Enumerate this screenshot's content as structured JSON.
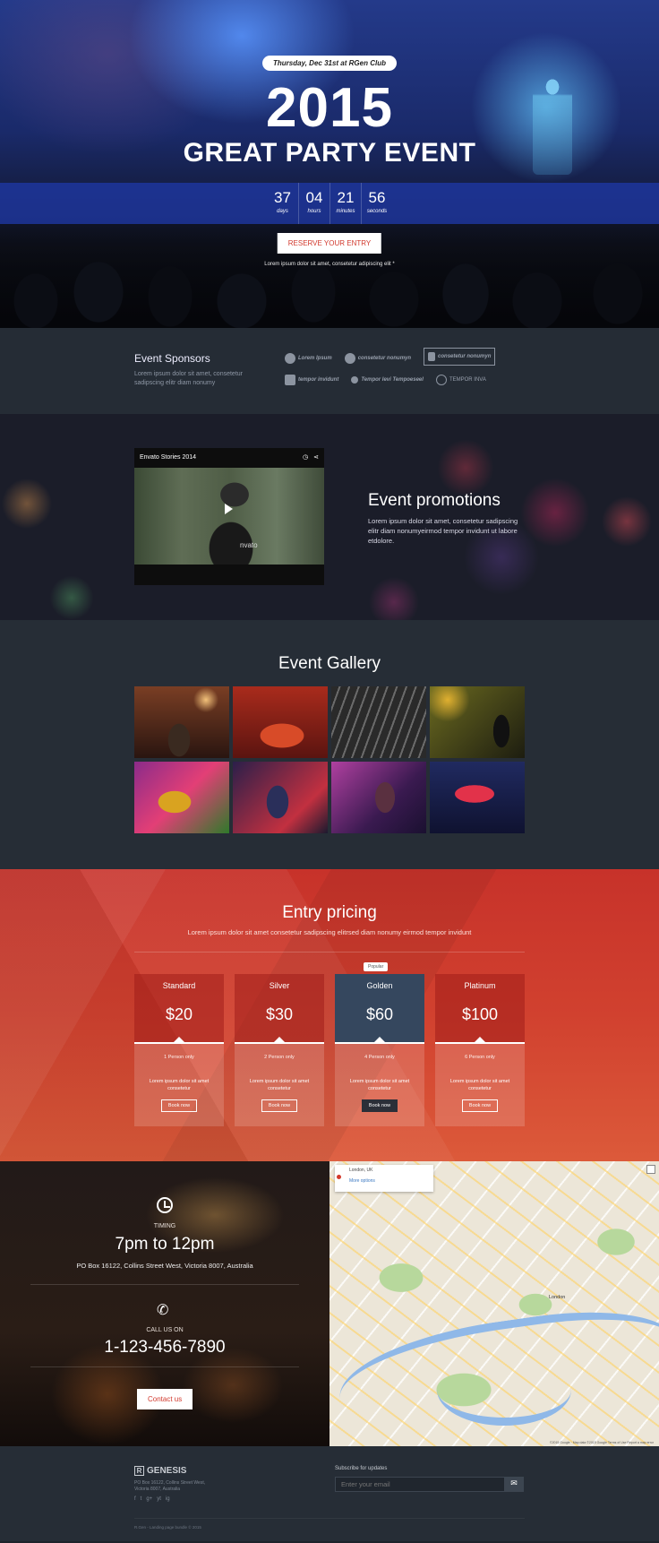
{
  "hero": {
    "date_badge": "Thursday, Dec 31st at RGen Club",
    "year": "2015",
    "title": "GREAT PARTY EVENT",
    "countdown": [
      {
        "value": "37",
        "label": "days"
      },
      {
        "value": "04",
        "label": "hours"
      },
      {
        "value": "21",
        "label": "minutes"
      },
      {
        "value": "56",
        "label": "seconds"
      }
    ],
    "reserve_label": "RESERVE YOUR ENTRY",
    "note": "Lorem ipsum dolor sit amet, consetetur adipiscing elit *"
  },
  "sponsors": {
    "title": "Event Sponsors",
    "text": "Lorem ipsum dolor sit amet, consetetur sadipscing elitr diam nonumy",
    "logos": [
      {
        "label": "Lorem Ipsum",
        "icon": "download-icon"
      },
      {
        "label": "consetetur nonumyn",
        "icon": "circle-logo-icon"
      },
      {
        "label": "consetetur nonumyn",
        "icon": "hourglass-icon"
      },
      {
        "label": "tempor invidunt",
        "icon": "search-logo-icon"
      },
      {
        "label": "Tempor levi Tempoeseel",
        "icon": "key-logo-icon"
      },
      {
        "label": "TEMPOR INVA",
        "icon": "globe-logo-icon"
      }
    ]
  },
  "promo": {
    "video_title": "Envato Stories 2014",
    "video_watermark": "nvato",
    "title": "Event promotions",
    "text": "Lorem ipsum dolor sit amet, consetetur sadipscing elitr diam nonumyeirmod tempor invidunt ut labore etdolore."
  },
  "gallery": {
    "title": "Event Gallery",
    "images": [
      "concert-crowd",
      "cocktail-glass",
      "guitar-closeup",
      "singer-on-stage",
      "saxophone-player",
      "singer-performing",
      "drummer",
      "radio-city-sign"
    ]
  },
  "pricing": {
    "title": "Entry pricing",
    "subtitle": "Lorem ipsum dolor sit amet consetetur sadipscing elitrsed diam nonumy eirmod tempor invidunt",
    "popular_badge": "Popular",
    "plans": [
      {
        "name": "Standard",
        "price": "$20",
        "persons": "1 Person only",
        "desc": "Lorem ipsum dolor sit amet consetetur",
        "button": "Book now"
      },
      {
        "name": "Silver",
        "price": "$30",
        "persons": "2 Person only",
        "desc": "Lorem ipsum dolor sit amet consetetur",
        "button": "Book now"
      },
      {
        "name": "Golden",
        "price": "$60",
        "persons": "4 Person only",
        "desc": "Lorem ipsum dolor sit amet consetetur",
        "button": "Book now"
      },
      {
        "name": "Platinum",
        "price": "$100",
        "persons": "6 Person only",
        "desc": "Lorem ipsum dolor sit amet consetetur",
        "button": "Book now"
      }
    ]
  },
  "contact": {
    "timing_label": "TIMING",
    "timing_value": "7pm to 12pm",
    "address": "PO Box 16122, Collins Street West, Victoria 8007, Australia",
    "call_label": "CALL US ON",
    "phone": "1-123-456-7890",
    "button": "Contact us"
  },
  "map": {
    "place": "London, UK",
    "more_options": "More options",
    "city_label": "London",
    "attribution": "©2015 Google · Map data ©2015 Google   Terms of Use   Report a map error"
  },
  "footer": {
    "brand": "GENESIS",
    "brand_mark": "R",
    "address": "PO Box 16122, Collins Street West, Victoria 8007, Australia",
    "social": [
      "f",
      "t",
      "g+",
      "yt",
      "ig"
    ],
    "copyright": "R.Gen - Landing page bundle © 2015",
    "subscribe_label": "Subscribe for updates",
    "email_placeholder": "Enter your email",
    "submit_icon": "✉"
  },
  "colors": {
    "accent_red": "#d23a2e",
    "countdown_blue": "#1e37a0",
    "featured_plan": "#35475e",
    "dark_bg": "#262d36"
  }
}
